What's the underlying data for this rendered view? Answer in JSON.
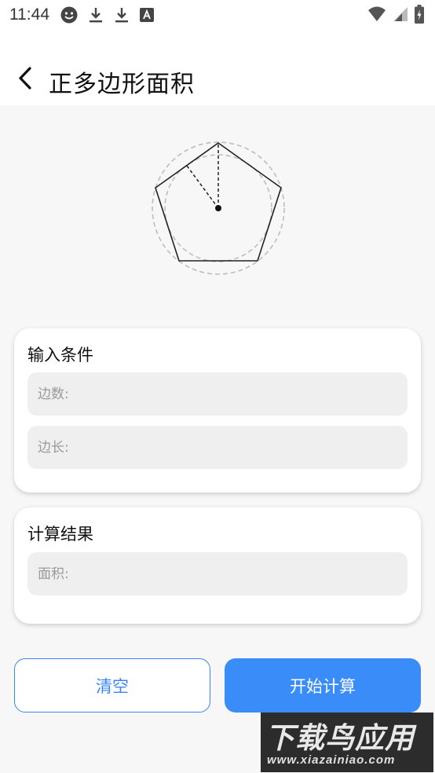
{
  "status_bar": {
    "time": "11:44",
    "left_icons": [
      "smiley-icon",
      "download-icon",
      "download-icon",
      "text-a-icon"
    ],
    "right_icons": [
      "wifi-icon",
      "cellular-icon",
      "battery-charging-icon"
    ]
  },
  "header": {
    "back_icon": "chevron-left-icon",
    "title": "正多边形面积"
  },
  "input_card": {
    "title": "输入条件",
    "fields": [
      {
        "placeholder": "边数:",
        "value": ""
      },
      {
        "placeholder": "边长:",
        "value": ""
      }
    ]
  },
  "result_card": {
    "title": "计算结果",
    "fields": [
      {
        "placeholder": "面积:",
        "value": ""
      }
    ]
  },
  "buttons": {
    "clear_label": "清空",
    "start_label": "开始计算"
  },
  "watermark": {
    "title": "下载鸟应用",
    "url": "www.xiazainiao.com"
  },
  "colors": {
    "accent": "#3a8cf8",
    "card_bg": "#ffffff",
    "page_bg": "#f7f7f7",
    "field_bg": "#efefef"
  }
}
